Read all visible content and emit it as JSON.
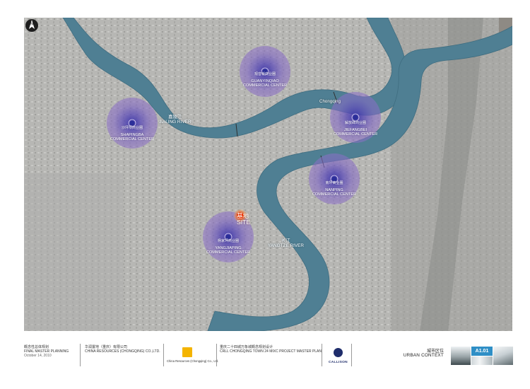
{
  "map": {
    "city_label": "Chongqing",
    "site": {
      "cn": "基地",
      "en": "SITE"
    },
    "rivers": [
      {
        "cn": "嘉陵江",
        "en": "JIALING RIVER"
      },
      {
        "cn": "长江",
        "en": "YANGTZE RIVER"
      }
    ],
    "centers": [
      {
        "cn": "观音桥商业圈",
        "en1": "GUANYINQIAO",
        "en2": "COMMERCIAL CENTER"
      },
      {
        "cn": "沙坪坝商业圈",
        "en1": "SHAPINGBA",
        "en2": "COMMERCIAL CENTER"
      },
      {
        "cn": "解放碑商业圈",
        "en1": "JIEFANGBEI",
        "en2": "COMMERCIAL CENTER"
      },
      {
        "cn": "南坪商业圈",
        "en1": "NANPING",
        "en2": "COMMERCIAL CENTER"
      },
      {
        "cn": "杨家坪商业圈",
        "en1": "YANGJIAPING",
        "en2": "COMMERCIAL CENTER"
      }
    ],
    "north_arrow_letter": "N",
    "colors": {
      "river": "#4f7f93",
      "river_edge": "#3f6d80",
      "ring_outer": "#7a63c4",
      "ring_mid": "#5c49b4",
      "ring_inner": "#3a34a3",
      "site_marker": "#f2551d"
    }
  },
  "title_block": {
    "project_phase_cn": "概念性总体规划",
    "project_phase_en": "FINAL MASTER PLANNING",
    "date": "October 14, 2010",
    "client_cn": "华润置地（重庆）有限公司",
    "client_en": "CHINA RESOURCES (CHONGQING) CO.,LTD.",
    "client_logo_caption": "China Resources (Chongqing) Co., Ltd.",
    "project_cn": "重庆二十四城万象城概念规划设计",
    "project_en": "CRLL CHONGQING TOWN 24 MIXC PROJECT MASTER PLAN",
    "architect": "CALLISON",
    "sheet_title_cn": "城市区位",
    "sheet_title_en": "URBAN CONTEXT",
    "sheet_number": "A1.01"
  }
}
